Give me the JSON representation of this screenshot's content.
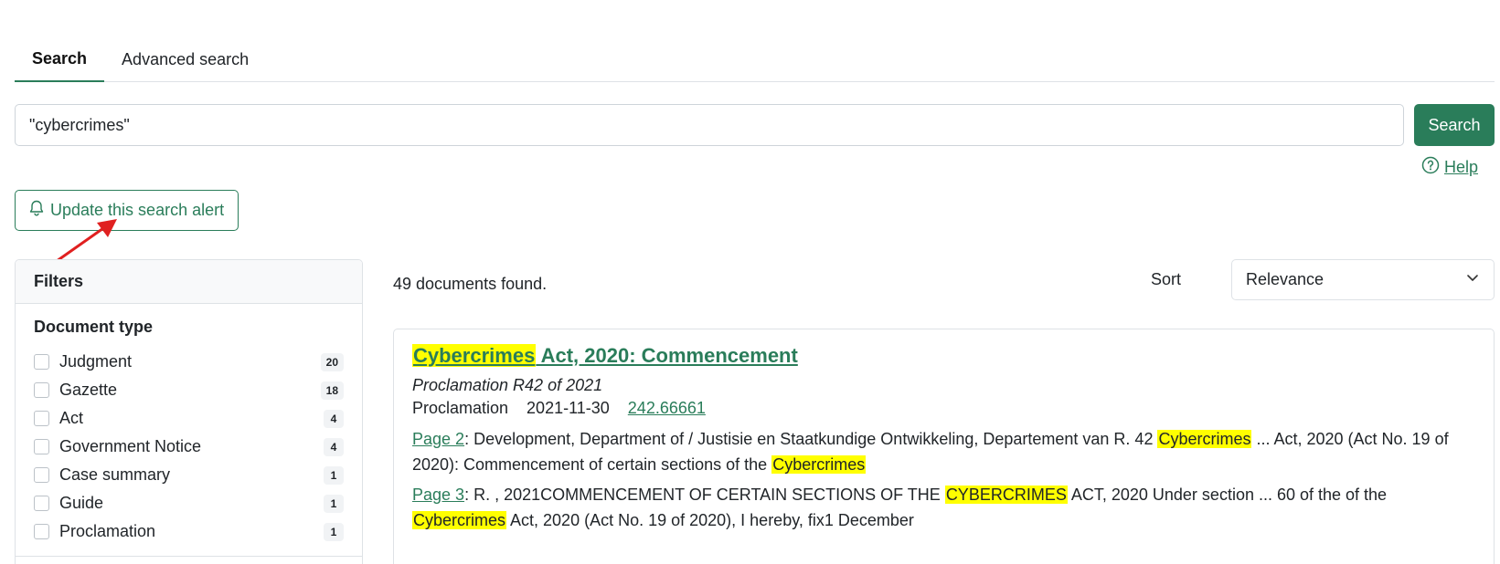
{
  "tabs": [
    {
      "label": "Search",
      "active": true
    },
    {
      "label": "Advanced search",
      "active": false
    }
  ],
  "search": {
    "value": "\"cybercrimes\"",
    "button_label": "Search"
  },
  "help_label": "Help",
  "alert_button_label": "Update this search alert",
  "filters": {
    "title": "Filters",
    "document_type_title": "Document type",
    "items": [
      {
        "label": "Judgment",
        "count": "20"
      },
      {
        "label": "Gazette",
        "count": "18"
      },
      {
        "label": "Act",
        "count": "4"
      },
      {
        "label": "Government Notice",
        "count": "4"
      },
      {
        "label": "Case summary",
        "count": "1"
      },
      {
        "label": "Guide",
        "count": "1"
      },
      {
        "label": "Proclamation",
        "count": "1"
      }
    ]
  },
  "results_count": "49 documents found.",
  "sort": {
    "label": "Sort",
    "value": "Relevance"
  },
  "result": {
    "title_highlight": "Cybercrimes",
    "title_rest": " Act, 2020: Commencement",
    "subtitle": "Proclamation R42 of 2021",
    "type": "Proclamation",
    "date": "2021-11-30",
    "score": "242.66661",
    "snippets": [
      {
        "page_label": "Page 2",
        "parts": [
          {
            "text": ": Development, Department of / Justisie en Staatkundige Ontwikkeling, Departement van R. 42 ",
            "hl": false
          },
          {
            "text": "Cybercrimes",
            "hl": true
          },
          {
            "text": " ... Act, 2020 (Act No. 19 of 2020): Commencement of certain sections of the ",
            "hl": false
          },
          {
            "text": "Cybercrimes",
            "hl": true
          }
        ]
      },
      {
        "page_label": "Page 3",
        "parts": [
          {
            "text": ": R. , 2021COMMENCEMENT OF CERTAIN SECTIONS OF THE ",
            "hl": false
          },
          {
            "text": "CYBERCRIMES",
            "hl": true
          },
          {
            "text": " ACT, 2020 Under section ... 60 of the of the ",
            "hl": false
          },
          {
            "text": "Cybercrimes",
            "hl": true
          },
          {
            "text": " Act, 2020 (Act No. 19 of 2020), I hereby, fix1 December",
            "hl": false
          }
        ]
      }
    ]
  },
  "colors": {
    "accent": "#2a7d5a",
    "highlight": "#ffff00",
    "annotation_arrow": "#e02020"
  },
  "icons": {
    "bell": "bell-icon",
    "help": "question-circle-icon",
    "chevron": "chevron-down-icon"
  }
}
